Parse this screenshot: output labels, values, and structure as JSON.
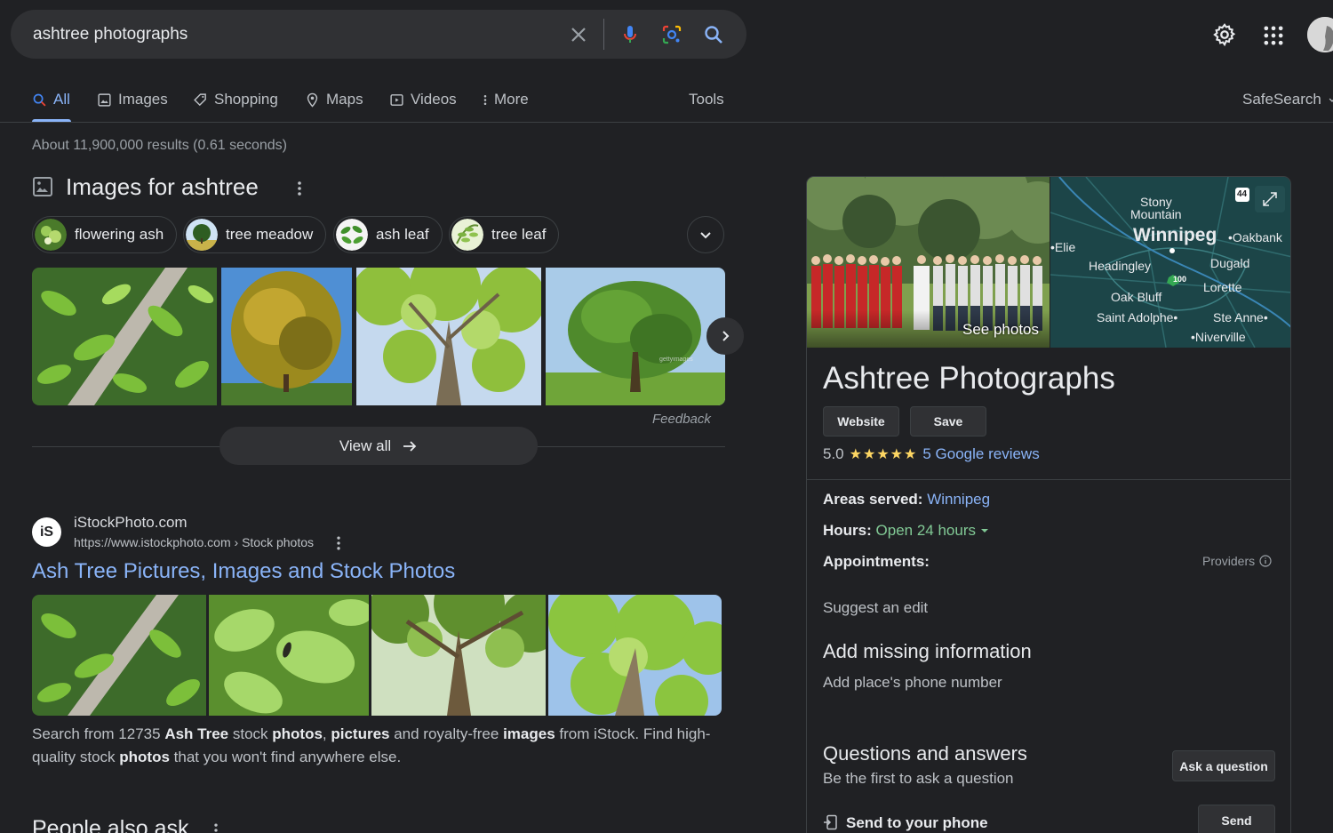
{
  "search": {
    "query": "ashtree photographs",
    "icons": [
      "clear-icon",
      "mic-icon",
      "lens-icon",
      "search-icon"
    ]
  },
  "header_icons": [
    "settings-icon",
    "apps-icon",
    "avatar"
  ],
  "tabs": [
    {
      "label": "All",
      "icon": "search-icon",
      "active": true
    },
    {
      "label": "Images",
      "icon": "image-icon"
    },
    {
      "label": "Shopping",
      "icon": "tag-icon"
    },
    {
      "label": "Maps",
      "icon": "pin-icon"
    },
    {
      "label": "Videos",
      "icon": "play-icon"
    },
    {
      "label": "More",
      "icon": "kebab-icon"
    },
    {
      "label": "Tools"
    }
  ],
  "safesearch_label": "SafeSearch",
  "stats": "About 11,900,000 results (0.61 seconds)",
  "images_section": {
    "title": "Images for ashtree",
    "chips": [
      "flowering ash",
      "tree meadow",
      "ash leaf",
      "tree leaf"
    ],
    "feedback": "Feedback",
    "view_all": "View all"
  },
  "result": {
    "site_name": "iStockPhoto.com",
    "favicon_text": "iS",
    "url": "https://www.istockphoto.com › Stock photos",
    "title": "Ash Tree Pictures, Images and Stock Photos",
    "snippet": {
      "p1": "Search from 12735 ",
      "b1": "Ash Tree",
      "p2": " stock ",
      "b2": "photos",
      "p3": ", ",
      "b3": "pictures",
      "p4": " and royalty-free ",
      "b4": "images",
      "p5": " from iStock. Find high-quality stock ",
      "b5": "photos",
      "p6": " that you won't find anywhere else."
    }
  },
  "people_also_ask": "People also ask",
  "knowledge_panel": {
    "see_photos": "See photos",
    "map_labels": {
      "stony": "Stony",
      "mountain": "Mountain",
      "winnipeg": "Winnipeg",
      "oakbank": "•Oakbank",
      "elie": "•Elie",
      "headingley": "Headingley",
      "dugald": "Dugald",
      "lorette": "Lorette",
      "oak_bluff": "Oak Bluff",
      "saint_adolphe": "Saint Adolphe•",
      "ste_anne": "Ste Anne•",
      "niverville": "•Niverville",
      "highway_44": "44",
      "highway_100": "100"
    },
    "title": "Ashtree Photographs",
    "website_btn": "Website",
    "save_btn": "Save",
    "rating": "5.0",
    "stars": "★★★★★",
    "reviews": "5 Google reviews",
    "areas_label": "Areas served:",
    "areas_value": "Winnipeg",
    "hours_label": "Hours:",
    "hours_value": "Open 24 hours",
    "appointments_label": "Appointments:",
    "providers": "Providers",
    "suggest_edit": "Suggest an edit",
    "add_missing": "Add missing information",
    "add_phone": "Add place's phone number",
    "qa_title": "Questions and answers",
    "qa_link": "Be the first to ask a question",
    "ask_btn": "Ask a question",
    "send_label": "Send to your phone",
    "send_btn": "Send"
  }
}
